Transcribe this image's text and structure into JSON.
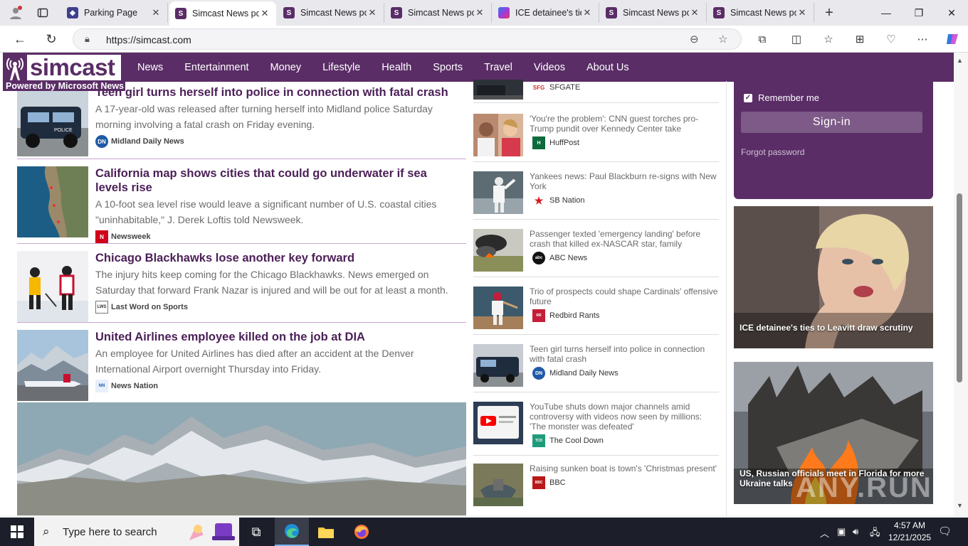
{
  "browser": {
    "tabs": [
      {
        "title": "Parking Page",
        "favicon": "parking-icon"
      },
      {
        "title": "Simcast News po",
        "favicon": "simcast-icon",
        "active": true
      },
      {
        "title": "Simcast News po",
        "favicon": "simcast-icon"
      },
      {
        "title": "Simcast News po",
        "favicon": "simcast-icon"
      },
      {
        "title": "ICE detainee's tie",
        "favicon": "msn-icon"
      },
      {
        "title": "Simcast News po",
        "favicon": "simcast-icon"
      },
      {
        "title": "Simcast News po",
        "favicon": "simcast-icon"
      }
    ],
    "url": "https://simcast.com"
  },
  "site": {
    "logo_text": "simcast",
    "powered_by": "Powered by Microsoft News",
    "menu": [
      "News",
      "Entertainment",
      "Money",
      "Lifestyle",
      "Health",
      "Sports",
      "Travel",
      "Videos",
      "About Us"
    ],
    "brand_color": "#5a2d66"
  },
  "left_articles": [
    {
      "title": "Teen girl turns herself into police in connection with fatal crash",
      "summary": "A 17-year-old was released after turning herself into Midland police Saturday morning involving a fatal crash on Friday evening.",
      "source": "Midland Daily News",
      "source_icon": "DN"
    },
    {
      "title": "California map shows cities that could go underwater if sea levels rise",
      "summary": "A 10-foot sea level rise would leave a significant number of U.S. coastal cities \"uninhabitable,\" J. Derek Loftis told Newsweek.",
      "source": "Newsweek",
      "source_icon": "N"
    },
    {
      "title": "Chicago Blackhawks lose another key forward",
      "summary": "The injury hits keep coming for the Chicago Blackhawks. News emerged on Saturday that forward Frank Nazar is injured and will be out for at least a month.",
      "source": "Last Word on Sports",
      "source_icon": "LWS"
    },
    {
      "title": "United Airlines employee killed on the job at DIA",
      "summary": "An employee for United Airlines has died after an accident at the Denver International Airport overnight Thursday into Friday.",
      "source": "News Nation",
      "source_icon": "NN"
    }
  ],
  "mid_articles": [
    {
      "title": "",
      "source": "SFGATE",
      "source_icon": "SFG"
    },
    {
      "title": "'You're the problem': CNN guest torches pro-Trump pundit over Kennedy Center take",
      "source": "HuffPost",
      "source_icon": "H"
    },
    {
      "title": "Yankees news: Paul Blackburn re-signs with New York",
      "source": "SB Nation",
      "source_icon": "★"
    },
    {
      "title": "Passenger texted 'emergency landing' before crash that killed ex-NASCAR star, family",
      "source": "ABC News",
      "source_icon": "abc"
    },
    {
      "title": "Trio of prospects could shape Cardinals' offensive future",
      "source": "Redbird Rants",
      "source_icon": "RR"
    },
    {
      "title": "Teen girl turns herself into police in connection with fatal crash",
      "source": "Midland Daily News",
      "source_icon": "DN"
    },
    {
      "title": "YouTube shuts down major channels amid controversy with videos now seen by millions: 'The monster was defeated'",
      "source": "The Cool Down",
      "source_icon": "TCD"
    },
    {
      "title": "Raising sunken boat is town's 'Christmas present'",
      "source": "BBC",
      "source_icon": "BBC"
    }
  ],
  "login": {
    "remember_label": "Remember me",
    "signin_label": "Sign-in",
    "forgot_label": "Forgot password"
  },
  "promos": [
    {
      "caption": "ICE detainee's ties to Leavitt draw scrutiny"
    },
    {
      "caption": "US, Russian officials meet in Florida for more Ukraine talks"
    }
  ],
  "taskbar": {
    "search_placeholder": "Type here to search",
    "time": "4:57 AM",
    "date": "12/21/2025"
  },
  "watermark": "ANY.RUN"
}
